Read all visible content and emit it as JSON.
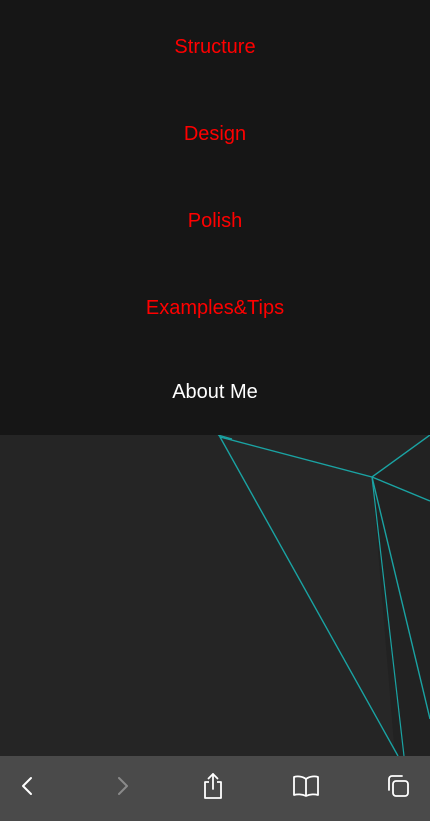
{
  "menu": {
    "items": [
      {
        "label": "Structure",
        "active": false
      },
      {
        "label": "Design",
        "active": false
      },
      {
        "label": "Polish",
        "active": false
      },
      {
        "label": "Examples&Tips",
        "active": false
      },
      {
        "label": "About Me",
        "active": true
      }
    ]
  },
  "colors": {
    "menu_background": "#161616",
    "link_color": "#ff0000",
    "active_link_color": "#ffffff",
    "hero_background": "#252525",
    "hero_line_color": "#1aa3a3",
    "toolbar_background": "#4a4a4a"
  },
  "toolbar": {
    "buttons": [
      {
        "icon": "back-chevron-icon",
        "enabled": true
      },
      {
        "icon": "forward-chevron-icon",
        "enabled": false
      },
      {
        "icon": "share-icon",
        "enabled": true
      },
      {
        "icon": "bookmarks-book-icon",
        "enabled": true
      },
      {
        "icon": "tabs-icon",
        "enabled": true
      }
    ]
  }
}
